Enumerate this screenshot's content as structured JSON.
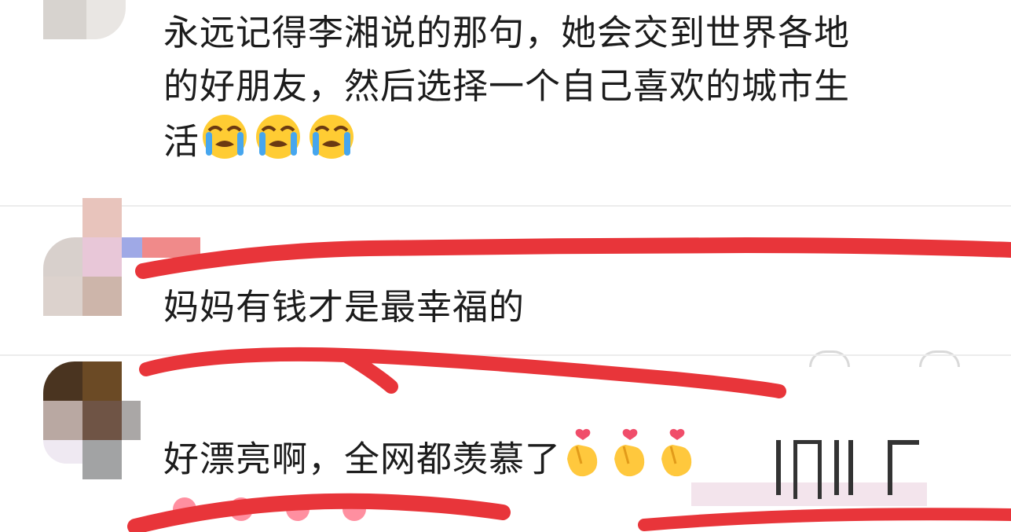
{
  "comments": [
    {
      "lines": [
        "永远记得李湘说的那句，她会交到世界各地",
        "的好朋友，然后选择一个自己喜欢的城市生",
        "活"
      ],
      "emoji": [
        "loudly-crying-face",
        "loudly-crying-face",
        "loudly-crying-face"
      ]
    },
    {
      "lines": [
        "妈妈有钱才是最幸福的"
      ],
      "emoji": []
    },
    {
      "lines": [
        "好漂亮啊，全网都羡慕了"
      ],
      "emoji": [
        "heart-hands-gesture",
        "heart-hands-gesture",
        "heart-hands-gesture"
      ]
    }
  ],
  "colors": {
    "annotation_red": "#e8353a",
    "text": "#1c1c1c",
    "divider": "#ececec",
    "icon_outline": "#d9d9d9"
  }
}
